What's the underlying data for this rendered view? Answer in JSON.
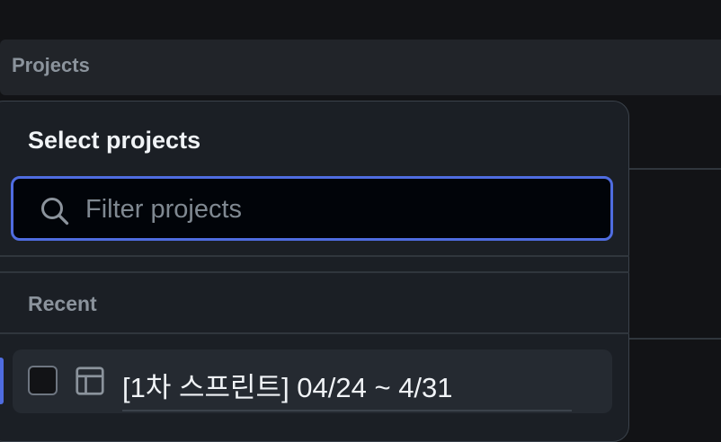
{
  "background": {
    "projects_label": "Projects"
  },
  "dialog": {
    "title": "Select projects",
    "search": {
      "value": "",
      "placeholder": "Filter projects",
      "icon": "search-icon"
    },
    "sections": [
      {
        "label": "Recent",
        "items": [
          {
            "name": "[1차 스프린트] 04/24 ~ 4/31",
            "checked": false,
            "icon": "table-icon"
          }
        ]
      }
    ]
  },
  "colors": {
    "accent": "#4f6ce0",
    "panel_bg": "#1b1f25",
    "page_bg": "#121316",
    "input_bg": "#010409"
  }
}
